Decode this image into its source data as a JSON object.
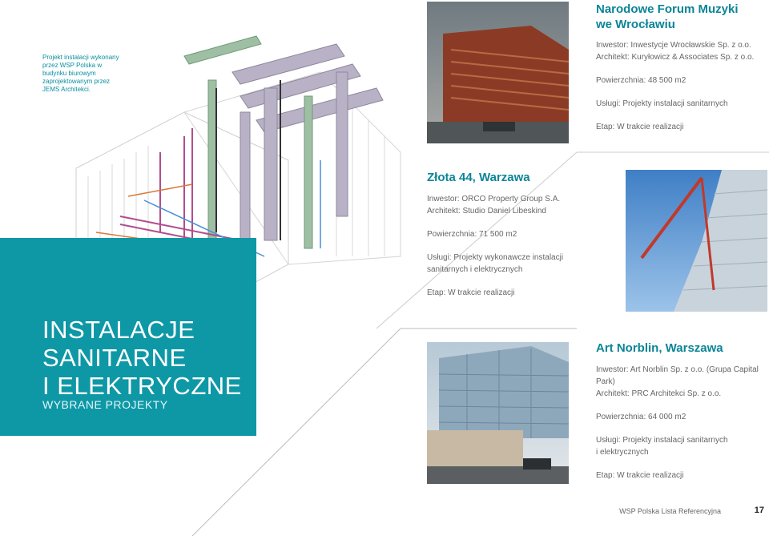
{
  "caption": "Projekt instalacji wykonany przez WSP Polska w budynku biurowym zaprojektowanym przez JEMS Architekci.",
  "section": {
    "title_lines": [
      "INSTALACJE",
      "SANITARNE",
      "I ELEKTRYCZNE"
    ],
    "subtitle": "WYBRANE PROJEKTY"
  },
  "projects": [
    {
      "title_lines": [
        "Narodowe Forum Muzyki",
        "we Wrocławiu"
      ],
      "investor": "Inwestor: Inwestycje Wrocławskie Sp. z o.o.",
      "architect": "Architekt: Kuryłowicz & Associates Sp. z o.o.",
      "area": "Powierzchnia: 48 500 m2",
      "services_lines": [
        "Usługi: Projekty instalacji sanitarnych"
      ],
      "stage": "Etap: W trakcie realizacji"
    },
    {
      "title_lines": [
        "Złota 44, Warzawa"
      ],
      "investor": "Inwestor: ORCO Property Group S.A.",
      "architect": "Architekt: Studio Daniel Libeskind",
      "area": "Powierzchnia: 71 500 m2",
      "services_lines": [
        "Usługi: Projekty wykonawcze instalacji",
        "sanitarnych i elektrycznych"
      ],
      "stage": "Etap: W trakcie realizacji"
    },
    {
      "title_lines": [
        "Art Norblin, Warszawa"
      ],
      "investor": "Inwestor: Art Norblin Sp. z o.o. (Grupa Capital Park)",
      "architect": "Architekt: PRC Architekci Sp. z o.o.",
      "area": "Powierzchnia: 64 000 m2",
      "services_lines": [
        "Usługi: Projekty instalacji sanitarnych",
        "i elektrycznych"
      ],
      "stage": "Etap: W trakcie realizacji"
    }
  ],
  "footer": {
    "text": "WSP Polska Lista Referencyjna",
    "page": "17"
  },
  "colors": {
    "accent": "#0e98a6",
    "title": "#0b8597"
  }
}
